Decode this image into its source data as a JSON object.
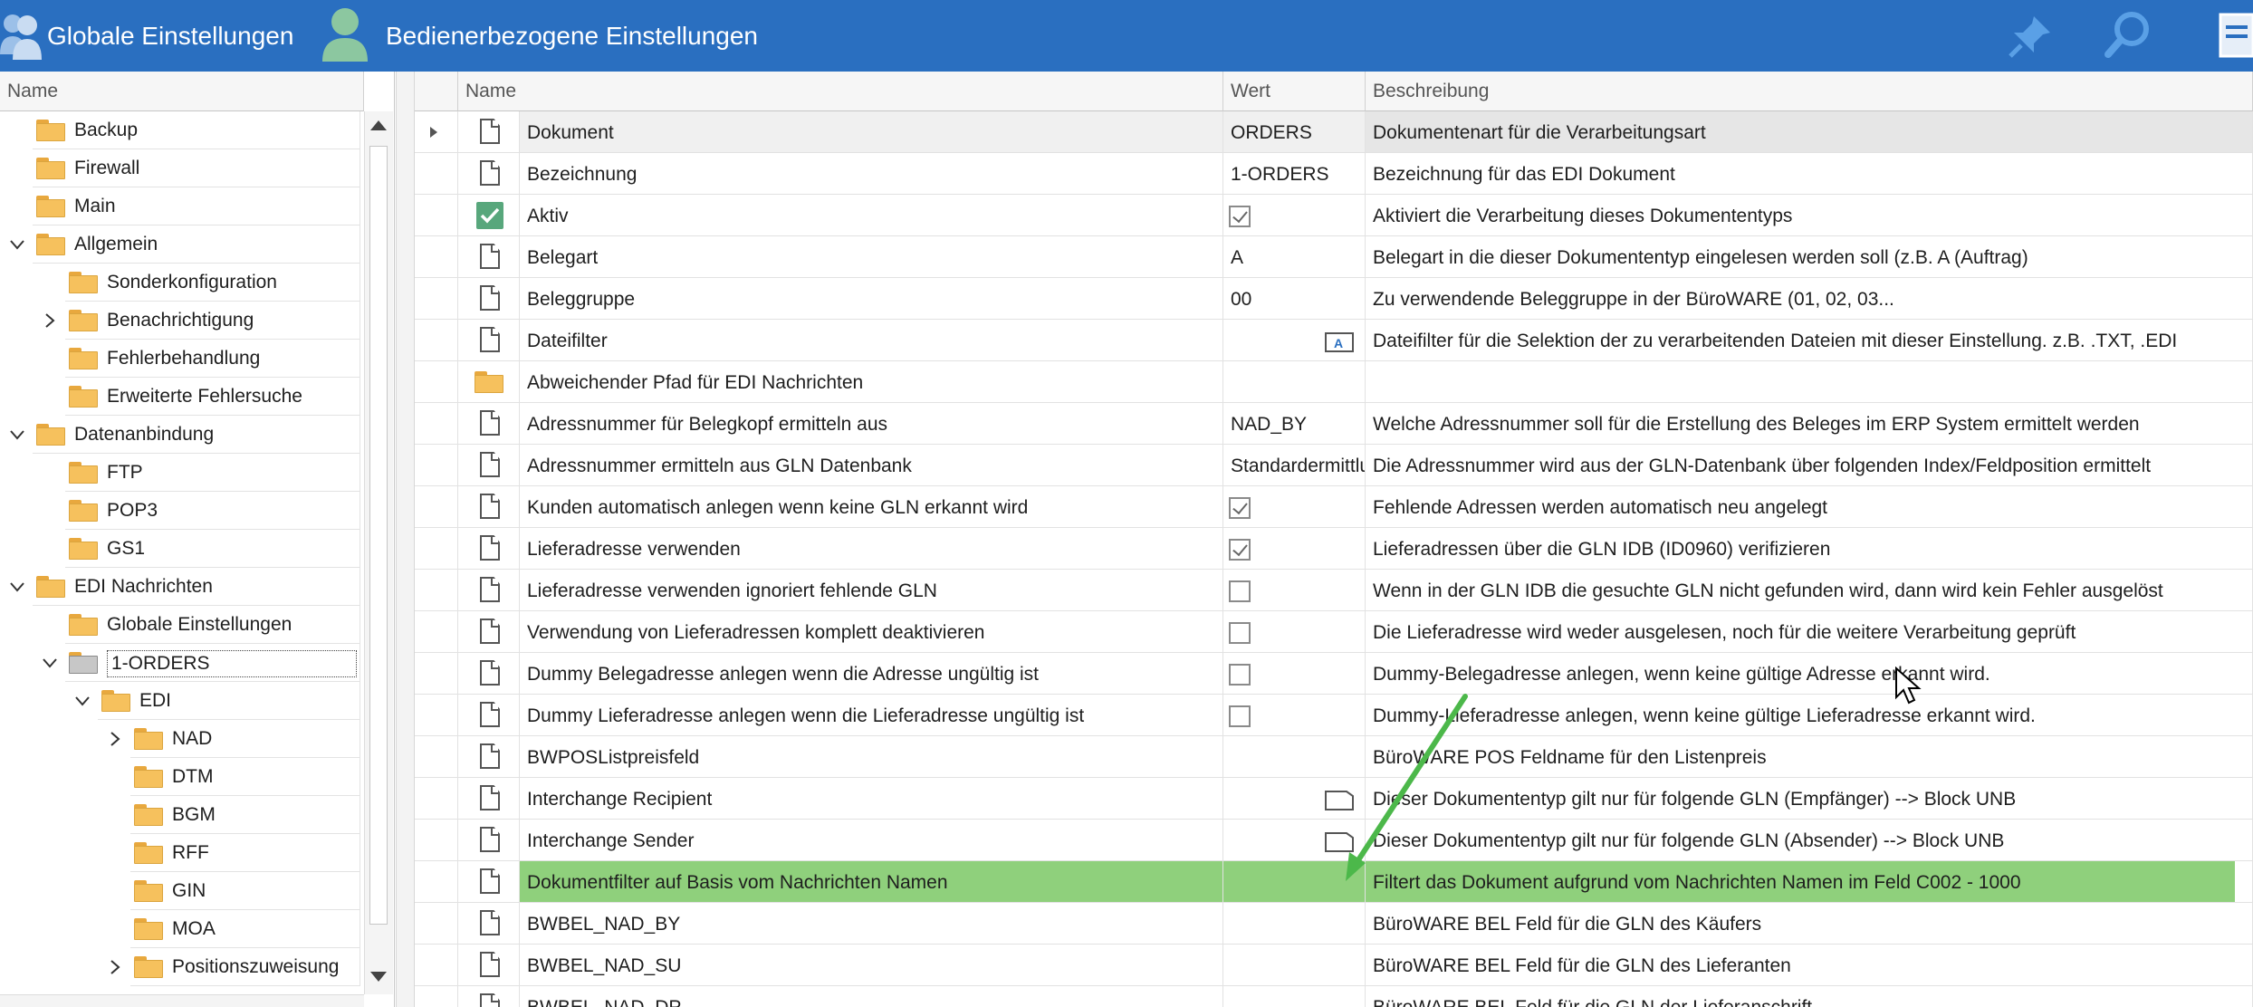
{
  "topbar": {
    "global_settings": "Globale Einstellungen",
    "operator_settings": "Bedienerbezogene Einstellungen",
    "color": "#2a6fc0"
  },
  "left_panel": {
    "header": "Name",
    "tree": [
      {
        "label": "Backup",
        "level": 0,
        "expander": ""
      },
      {
        "label": "Firewall",
        "level": 0,
        "expander": ""
      },
      {
        "label": "Main",
        "level": 0,
        "expander": ""
      },
      {
        "label": "Allgemein",
        "level": 0,
        "expander": "expanded"
      },
      {
        "label": "Sonderkonfiguration",
        "level": 1,
        "expander": ""
      },
      {
        "label": "Benachrichtigung",
        "level": 1,
        "expander": "collapsed"
      },
      {
        "label": "Fehlerbehandlung",
        "level": 1,
        "expander": ""
      },
      {
        "label": "Erweiterte Fehlersuche",
        "level": 1,
        "expander": ""
      },
      {
        "label": "Datenanbindung",
        "level": 0,
        "expander": "expanded"
      },
      {
        "label": "FTP",
        "level": 1,
        "expander": ""
      },
      {
        "label": "POP3",
        "level": 1,
        "expander": ""
      },
      {
        "label": "GS1",
        "level": 1,
        "expander": ""
      },
      {
        "label": "EDI Nachrichten",
        "level": 0,
        "expander": "expanded"
      },
      {
        "label": "Globale Einstellungen",
        "level": 1,
        "expander": ""
      },
      {
        "label": "1-ORDERS",
        "level": 1,
        "expander": "expanded",
        "editing": true
      },
      {
        "label": "EDI",
        "level": 2,
        "expander": "expanded"
      },
      {
        "label": "NAD",
        "level": 3,
        "expander": "collapsed"
      },
      {
        "label": "DTM",
        "level": 3,
        "expander": ""
      },
      {
        "label": "BGM",
        "level": 3,
        "expander": ""
      },
      {
        "label": "RFF",
        "level": 3,
        "expander": ""
      },
      {
        "label": "GIN",
        "level": 3,
        "expander": ""
      },
      {
        "label": "MOA",
        "level": 3,
        "expander": ""
      },
      {
        "label": "Positionszuweisung",
        "level": 3,
        "expander": "collapsed"
      }
    ]
  },
  "grid": {
    "columns": {
      "name": "Name",
      "value": "Wert",
      "description": "Beschreibung"
    },
    "rows": [
      {
        "icon": "doc",
        "name": "Dokument",
        "value": "ORDERS",
        "value_type": "text",
        "description": "Dokumentenart für die Verarbeitungsart",
        "current": true
      },
      {
        "icon": "doc",
        "name": "Bezeichnung",
        "value": "1-ORDERS",
        "value_type": "text",
        "description": "Bezeichnung für das EDI Dokument"
      },
      {
        "icon": "check",
        "name": "Aktiv",
        "value": "",
        "value_type": "checked",
        "description": "Aktiviert die Verarbeitung dieses Dokumententyps"
      },
      {
        "icon": "doc",
        "name": "Belegart",
        "value": "A",
        "value_type": "text",
        "description": "Belegart in die dieser Dokumententyp eingelesen werden soll (z.B. A (Auftrag)"
      },
      {
        "icon": "doc",
        "name": "Beleggruppe",
        "value": "00",
        "value_type": "text",
        "description": "Zu verwendende Beleggruppe in der BüroWARE (01, 02, 03..."
      },
      {
        "icon": "doc",
        "name": "Dateifilter",
        "value": "",
        "value_type": "text-editor",
        "description": "Dateifilter für die Selektion der zu verarbeitenden Dateien mit dieser Einstellung. z.B. .TXT, .EDI"
      },
      {
        "icon": "folder",
        "name": "Abweichender Pfad für EDI Nachrichten",
        "value": "",
        "value_type": "text",
        "description": ""
      },
      {
        "icon": "doc",
        "name": "Adressnummer für Belegkopf ermitteln aus",
        "value": "NAD_BY",
        "value_type": "text",
        "description": "Welche Adressnummer soll für die Erstellung des Beleges im ERP System ermittelt werden"
      },
      {
        "icon": "doc",
        "name": "Adressnummer ermitteln aus GLN Datenbank",
        "value": "Standardermittlung",
        "value_type": "text",
        "description": "Die Adressnummer wird aus der GLN-Datenbank über folgenden Index/Feldposition ermittelt"
      },
      {
        "icon": "doc",
        "name": "Kunden automatisch anlegen wenn keine GLN erkannt wird",
        "value": "",
        "value_type": "checked",
        "description": "Fehlende Adressen werden automatisch neu angelegt"
      },
      {
        "icon": "doc",
        "name": "Lieferadresse verwenden",
        "value": "",
        "value_type": "checked",
        "description": "Lieferadressen über die GLN IDB (ID0960) verifizieren"
      },
      {
        "icon": "doc",
        "name": "Lieferadresse verwenden ignoriert fehlende GLN",
        "value": "",
        "value_type": "unchecked",
        "description": "Wenn in der GLN IDB die gesuchte GLN nicht gefunden wird, dann wird kein Fehler ausgelöst"
      },
      {
        "icon": "doc",
        "name": "Verwendung von Lieferadressen komplett deaktivieren",
        "value": "",
        "value_type": "unchecked",
        "description": "Die Lieferadresse wird weder ausgelesen, noch für die weitere Verarbeitung geprüft"
      },
      {
        "icon": "doc",
        "name": "Dummy Belegadresse anlegen wenn die Adresse ungültig ist",
        "value": "",
        "value_type": "unchecked",
        "description": "Dummy-Belegadresse anlegen, wenn keine gültige Adresse erkannt wird."
      },
      {
        "icon": "doc",
        "name": "Dummy Lieferadresse anlegen wenn die Lieferadresse ungültig ist",
        "value": "",
        "value_type": "unchecked",
        "description": "Dummy-Lieferadresse anlegen, wenn keine gültige Lieferadresse erkannt wird."
      },
      {
        "icon": "doc",
        "name": "BWPOSListpreisfeld",
        "value": "",
        "value_type": "text",
        "description": "BüroWARE POS Feldname für den Listenpreis"
      },
      {
        "icon": "doc",
        "name": "Interchange Recipient",
        "value": "",
        "value_type": "memo",
        "description": "Dieser Dokumententyp gilt nur für folgende GLN (Empfänger) --> Block UNB"
      },
      {
        "icon": "doc",
        "name": "Interchange Sender",
        "value": "",
        "value_type": "memo",
        "description": "Dieser Dokumententyp gilt nur für folgende GLN (Absender) --> Block UNB"
      },
      {
        "icon": "doc",
        "name": "Dokumentfilter auf Basis vom Nachrichten Namen",
        "value": "",
        "value_type": "text",
        "description": "Filtert das Dokument aufgrund vom Nachrichten Namen im Feld C002 - 1000",
        "highlight": true
      },
      {
        "icon": "doc",
        "name": "BWBEL_NAD_BY",
        "value": "",
        "value_type": "text",
        "description": "BüroWARE BEL Feld für die GLN des Käufers"
      },
      {
        "icon": "doc",
        "name": "BWBEL_NAD_SU",
        "value": "",
        "value_type": "text",
        "description": "BüroWARE BEL Feld für die GLN des Lieferanten"
      },
      {
        "icon": "doc",
        "name": "BWBEL_NAD_DP",
        "value": "",
        "value_type": "text",
        "description": "BüroWARE BEL Feld für die GLN der Lieferanschrift"
      }
    ]
  },
  "colors": {
    "highlight": "#8fd07c",
    "arrow": "#4cb84a",
    "accent": "#2a6fc0"
  }
}
